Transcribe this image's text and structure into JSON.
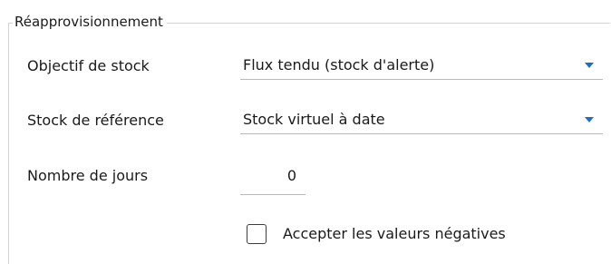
{
  "group": {
    "title": "Réapprovisionnement"
  },
  "fields": {
    "stock_objective": {
      "label": "Objectif de stock",
      "value": "Flux tendu (stock d'alerte)"
    },
    "reference_stock": {
      "label": "Stock de référence",
      "value": "Stock virtuel à date"
    },
    "days": {
      "label": "Nombre de jours",
      "value": "0"
    }
  },
  "checkbox": {
    "label": "Accepter les valeurs négatives",
    "checked": false
  },
  "colors": {
    "accent_arrow": "#1c6fc4",
    "frame": "#d4d4d4",
    "underline": "#b9b9b9"
  },
  "icons": {
    "dropdown": "chevron-down-icon"
  }
}
